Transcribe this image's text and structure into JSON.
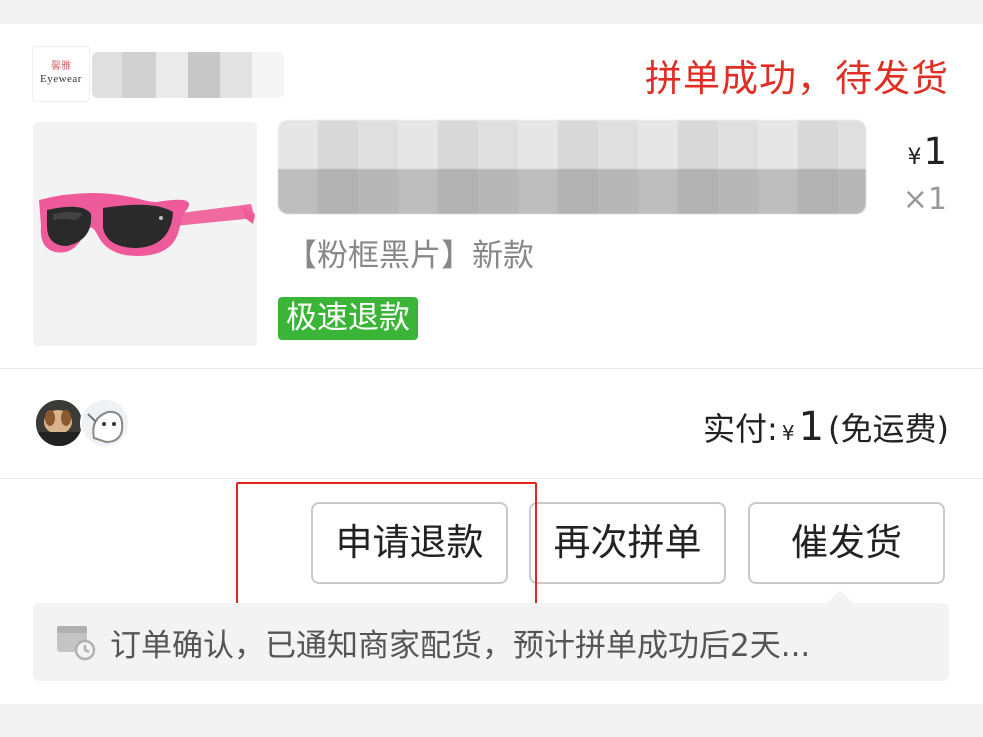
{
  "shop": {
    "logo_top": "馨雅",
    "logo_bottom": "Eyewear",
    "name": ""
  },
  "order": {
    "status": "拼单成功，待发货",
    "colors": {
      "status": "#e02e24",
      "fast_refund_bg": "#3bb537",
      "highlight": "#e8241c"
    }
  },
  "product": {
    "image": "pink-sunglasses",
    "title": "",
    "spec": "【粉框黑片】新款",
    "badge": "极速退款",
    "price_symbol": "¥",
    "price": "1",
    "quantity": "×1"
  },
  "summary": {
    "label": "实付:",
    "currency": "¥",
    "amount": "1",
    "shipping": "(免运费)"
  },
  "actions": {
    "refund": "申请退款",
    "regroup": "再次拼单",
    "urge": "催发货"
  },
  "notice": {
    "icon": "calendar-clock-icon",
    "text": "订单确认，已通知商家配货，预计拼单成功后2天..."
  }
}
